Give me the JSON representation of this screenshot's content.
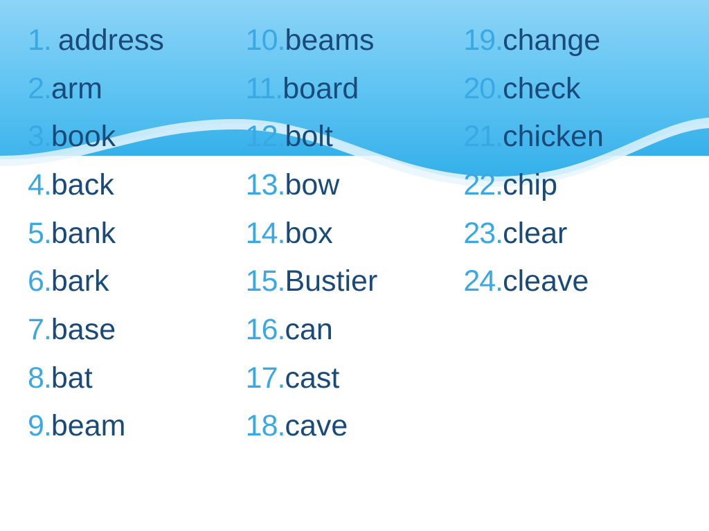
{
  "columns": [
    [
      {
        "num": "1.",
        "word": "address",
        "firstSpace": true
      },
      {
        "num": "2.",
        "word": "arm"
      },
      {
        "num": "3.",
        "word": "book"
      },
      {
        "num": "4.",
        "word": "back"
      },
      {
        "num": "5.",
        "word": "bank"
      },
      {
        "num": "6.",
        "word": "bark"
      },
      {
        "num": "7.",
        "word": "base"
      },
      {
        "num": "8.",
        "word": "bat"
      },
      {
        "num": "9.",
        "word": "beam"
      }
    ],
    [
      {
        "num": "10.",
        "word": "beams"
      },
      {
        "num": "11.",
        "word": "board"
      },
      {
        "num": "12.",
        "word": "bolt"
      },
      {
        "num": "13.",
        "word": "bow"
      },
      {
        "num": "14.",
        "word": "box"
      },
      {
        "num": "15.",
        "word": "Bustier"
      },
      {
        "num": "16.",
        "word": "can"
      },
      {
        "num": "17.",
        "word": "cast"
      },
      {
        "num": "18.",
        "word": "cave"
      }
    ],
    [
      {
        "num": "19.",
        "word": "change"
      },
      {
        "num": "20.",
        "word": "check"
      },
      {
        "num": "21.",
        "word": "chicken"
      },
      {
        "num": "22.",
        "word": "chip"
      },
      {
        "num": "23.",
        "word": "clear"
      },
      {
        "num": "24.",
        "word": "cleave"
      }
    ]
  ]
}
